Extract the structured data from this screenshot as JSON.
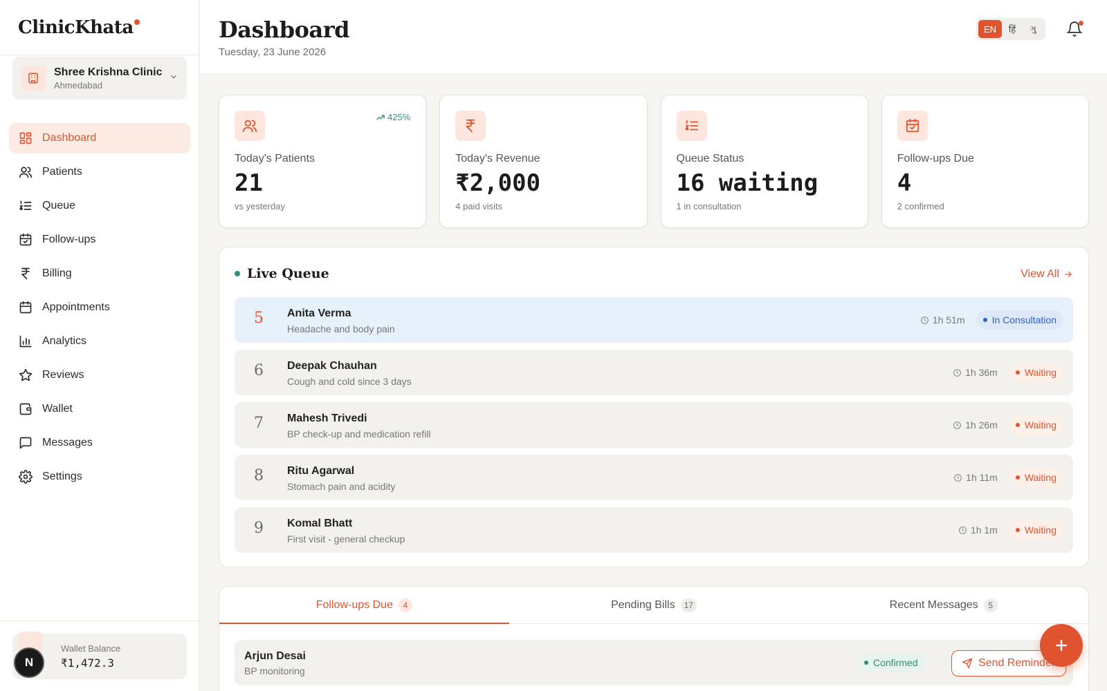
{
  "brand": {
    "name": "ClinicKhata"
  },
  "clinic": {
    "name": "Shree Krishna Clinic",
    "city": "Ahmedabad"
  },
  "nav": [
    {
      "label": "Dashboard",
      "icon": "dashboard-icon",
      "active": true
    },
    {
      "label": "Patients",
      "icon": "users-icon"
    },
    {
      "label": "Queue",
      "icon": "list-numbered-icon"
    },
    {
      "label": "Follow-ups",
      "icon": "calendar-check-icon"
    },
    {
      "label": "Billing",
      "icon": "rupee-icon"
    },
    {
      "label": "Appointments",
      "icon": "calendar-icon"
    },
    {
      "label": "Analytics",
      "icon": "bar-chart-icon"
    },
    {
      "label": "Reviews",
      "icon": "star-icon"
    },
    {
      "label": "Wallet",
      "icon": "wallet-icon"
    },
    {
      "label": "Messages",
      "icon": "message-icon"
    },
    {
      "label": "Settings",
      "icon": "gear-icon"
    }
  ],
  "wallet": {
    "label": "Wallet Balance",
    "value": "₹1,472.3"
  },
  "avatar": {
    "initial": "N"
  },
  "header": {
    "title": "Dashboard",
    "date": "Tuesday, 23 June 2026",
    "languages": [
      "EN",
      "हिं",
      "ગુ"
    ],
    "active_language": "EN"
  },
  "stats": [
    {
      "label": "Today's Patients",
      "value": "21",
      "sub": "vs yesterday",
      "trend": "425%",
      "icon": "users-icon"
    },
    {
      "label": "Today's Revenue",
      "value": "₹2,000",
      "sub": "4 paid visits",
      "icon": "rupee-icon"
    },
    {
      "label": "Queue Status",
      "value": "16 waiting",
      "sub": "1 in consultation",
      "icon": "list-numbered-icon"
    },
    {
      "label": "Follow-ups Due",
      "value": "4",
      "sub": "2 confirmed",
      "icon": "calendar-check-icon"
    }
  ],
  "queue": {
    "title": "Live Queue",
    "view_all": "View All",
    "items": [
      {
        "num": "5",
        "name": "Anita Verma",
        "note": "Headache and body pain",
        "time": "1h 51m",
        "status": "In Consultation",
        "current": true
      },
      {
        "num": "6",
        "name": "Deepak Chauhan",
        "note": "Cough and cold since 3 days",
        "time": "1h 36m",
        "status": "Waiting"
      },
      {
        "num": "7",
        "name": "Mahesh Trivedi",
        "note": "BP check-up and medication refill",
        "time": "1h 26m",
        "status": "Waiting"
      },
      {
        "num": "8",
        "name": "Ritu Agarwal",
        "note": "Stomach pain and acidity",
        "time": "1h 11m",
        "status": "Waiting"
      },
      {
        "num": "9",
        "name": "Komal Bhatt",
        "note": "First visit - general checkup",
        "time": "1h 1m",
        "status": "Waiting"
      }
    ]
  },
  "tabs": [
    {
      "label": "Follow-ups Due",
      "count": "4",
      "active": true
    },
    {
      "label": "Pending Bills",
      "count": "17"
    },
    {
      "label": "Recent Messages",
      "count": "5"
    }
  ],
  "followup": {
    "name": "Arjun Desai",
    "note": "BP monitoring",
    "status": "Confirmed",
    "action": "Send Reminder"
  },
  "colors": {
    "accent": "#e0532f",
    "teal": "#2f8f7a",
    "consult_blue": "#2b5fd0"
  }
}
